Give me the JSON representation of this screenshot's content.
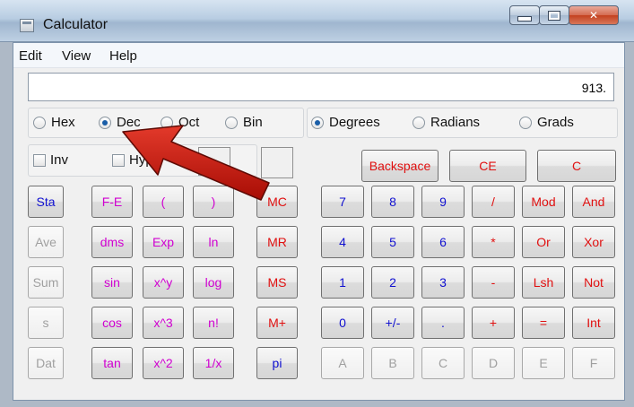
{
  "window": {
    "title": "Calculator"
  },
  "menu": [
    "Edit",
    "View",
    "Help"
  ],
  "display": {
    "value": "913."
  },
  "number_system": {
    "options": [
      "Hex",
      "Dec",
      "Oct",
      "Bin"
    ],
    "selected": "Dec"
  },
  "angle_units": {
    "options": [
      "Degrees",
      "Radians",
      "Grads"
    ],
    "selected": "Degrees"
  },
  "checkboxes": {
    "inv": "Inv",
    "hyp": "Hyp"
  },
  "edit_buttons": {
    "backspace": "Backspace",
    "ce": "CE",
    "c": "C"
  },
  "stat_buttons": [
    "Sta",
    "Ave",
    "Sum",
    "s",
    "Dat"
  ],
  "function_buttons": [
    [
      "F-E",
      "(",
      ")"
    ],
    [
      "dms",
      "Exp",
      "ln"
    ],
    [
      "sin",
      "x^y",
      "log"
    ],
    [
      "cos",
      "x^3",
      "n!"
    ],
    [
      "tan",
      "x^2",
      "1/x"
    ]
  ],
  "memory_buttons": [
    "MC",
    "MR",
    "MS",
    "M+",
    "pi"
  ],
  "keypad": [
    [
      "7",
      "8",
      "9",
      "/",
      "Mod",
      "And"
    ],
    [
      "4",
      "5",
      "6",
      "*",
      "Or",
      "Xor"
    ],
    [
      "1",
      "2",
      "3",
      "-",
      "Lsh",
      "Not"
    ],
    [
      "0",
      "+/-",
      ".",
      "+",
      "=",
      "Int"
    ],
    [
      "A",
      "B",
      "C",
      "D",
      "E",
      "F"
    ]
  ],
  "colors": {
    "accent_red": "#e01010",
    "blue": "#1010d0",
    "magenta": "#d000d0",
    "arrow_red": "#c41208"
  }
}
